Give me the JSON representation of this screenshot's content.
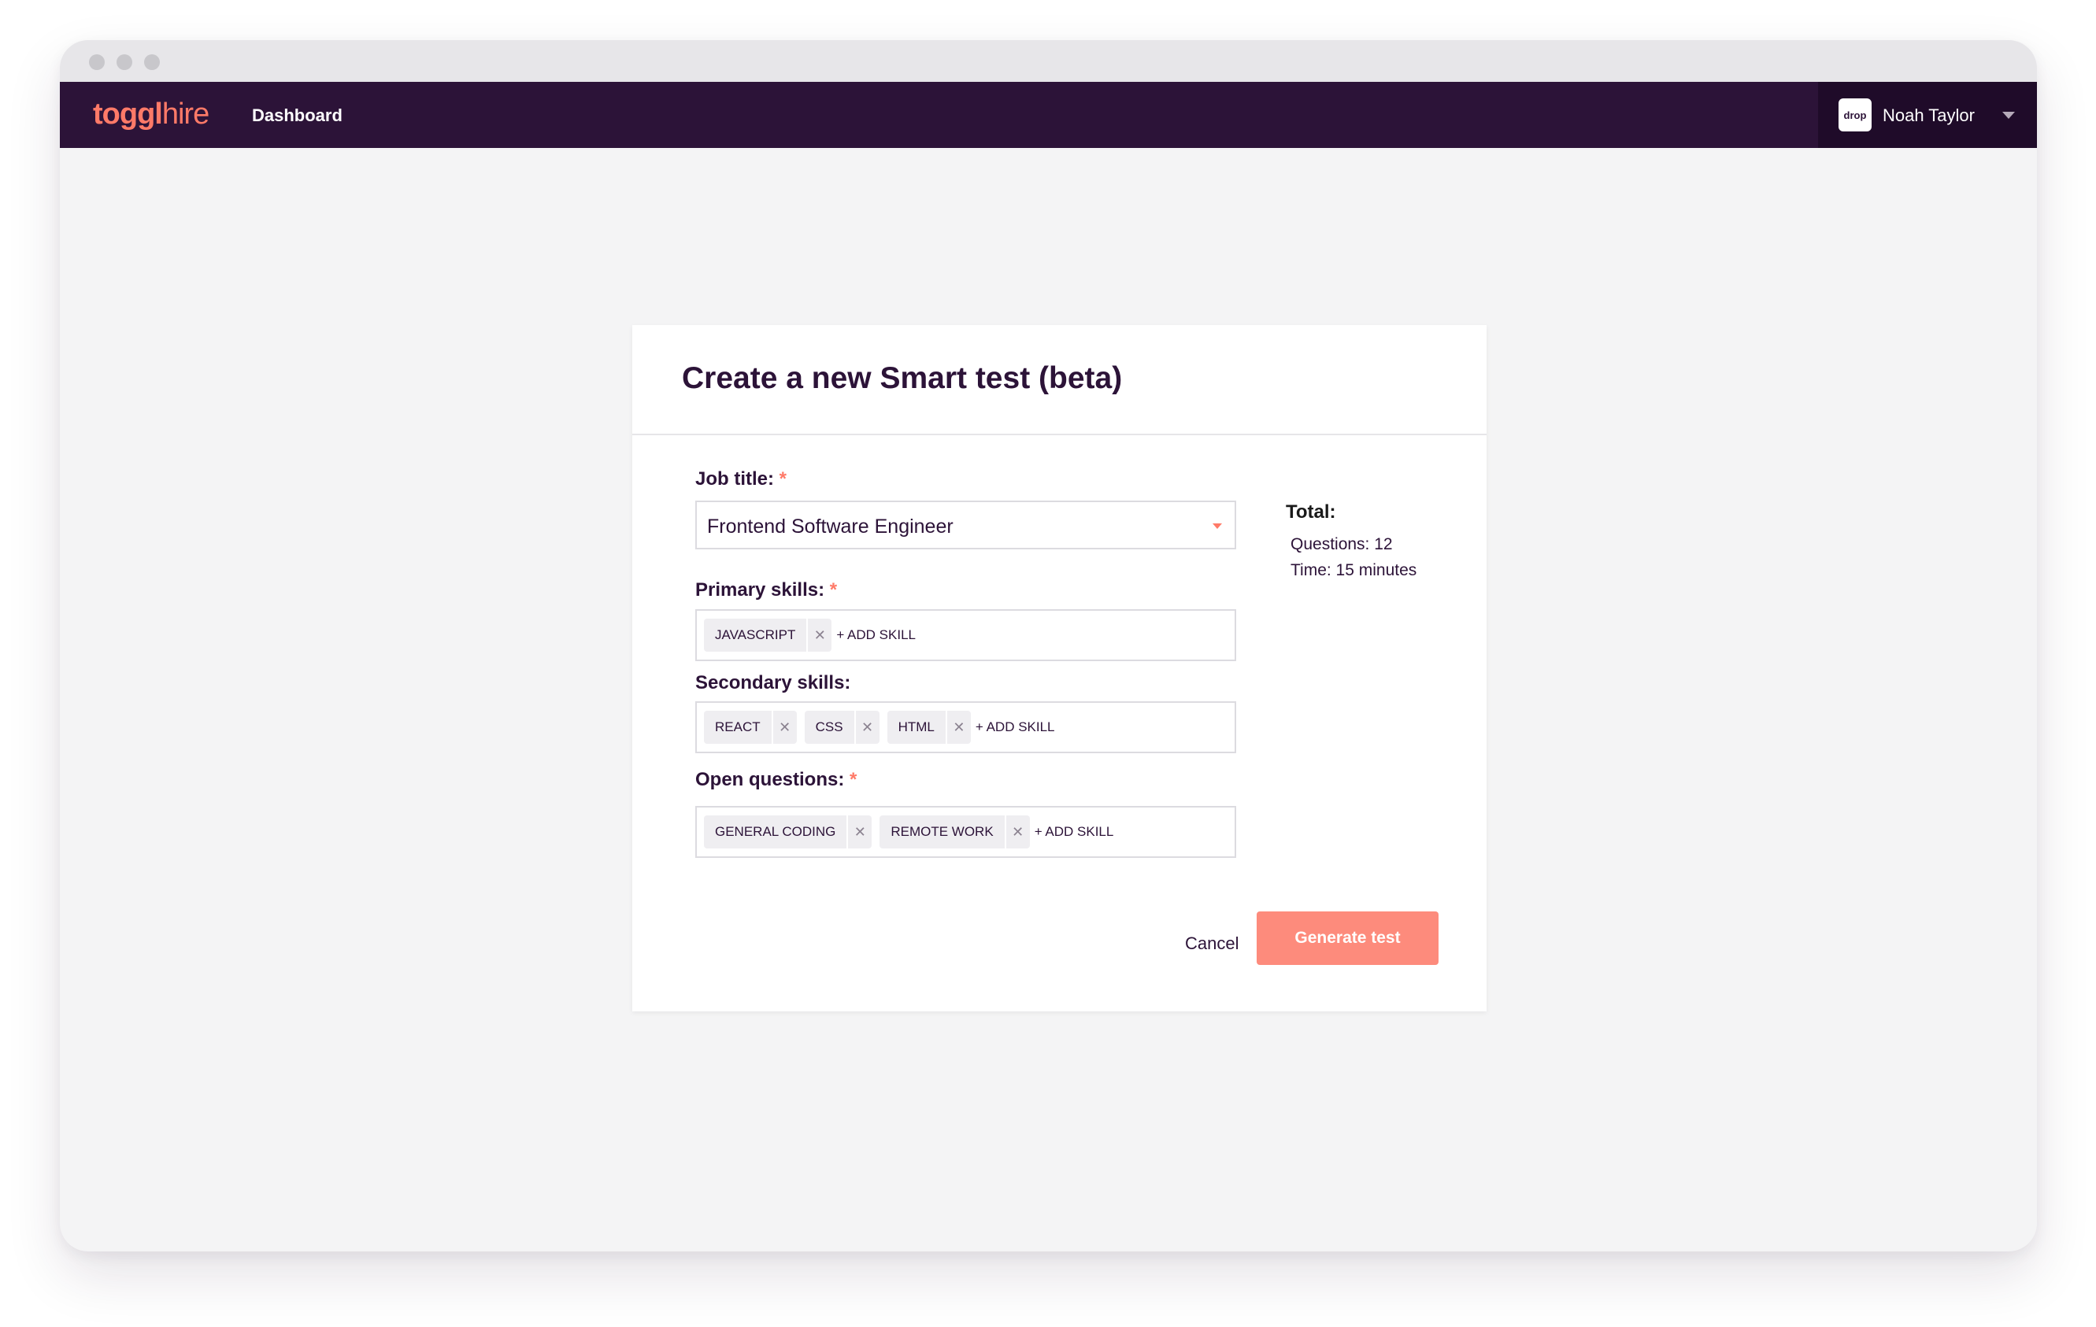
{
  "app": {
    "logo_bold": "toggl",
    "logo_light": "hire",
    "nav_dashboard": "Dashboard",
    "user": {
      "avatar_text": "drop",
      "name": "Noah Taylor"
    }
  },
  "dialog": {
    "title": "Create a new Smart test (beta)",
    "job_title": {
      "label": "Job title:",
      "required_mark": "*",
      "value": "Frontend Software Engineer"
    },
    "primary_skills": {
      "label": "Primary skills:",
      "required_mark": "*",
      "tags": [
        "JAVASCRIPT"
      ],
      "add_label": "+ ADD SKILL"
    },
    "secondary_skills": {
      "label": "Secondary skills:",
      "tags": [
        "REACT",
        "CSS",
        "HTML"
      ],
      "add_label": "+ ADD SKILL"
    },
    "open_questions": {
      "label": "Open questions:",
      "required_mark": "*",
      "tags": [
        "GENERAL CODING",
        "REMOTE WORK"
      ],
      "add_label": "+ ADD SKILL"
    },
    "total": {
      "title": "Total:",
      "questions": "Questions: 12",
      "time": "Time: 15 minutes"
    },
    "cancel_label": "Cancel",
    "generate_label": "Generate test"
  },
  "colors": {
    "nav_bg": "#2c1338",
    "accent": "#ff7a68",
    "button": "#fd8b7c"
  }
}
